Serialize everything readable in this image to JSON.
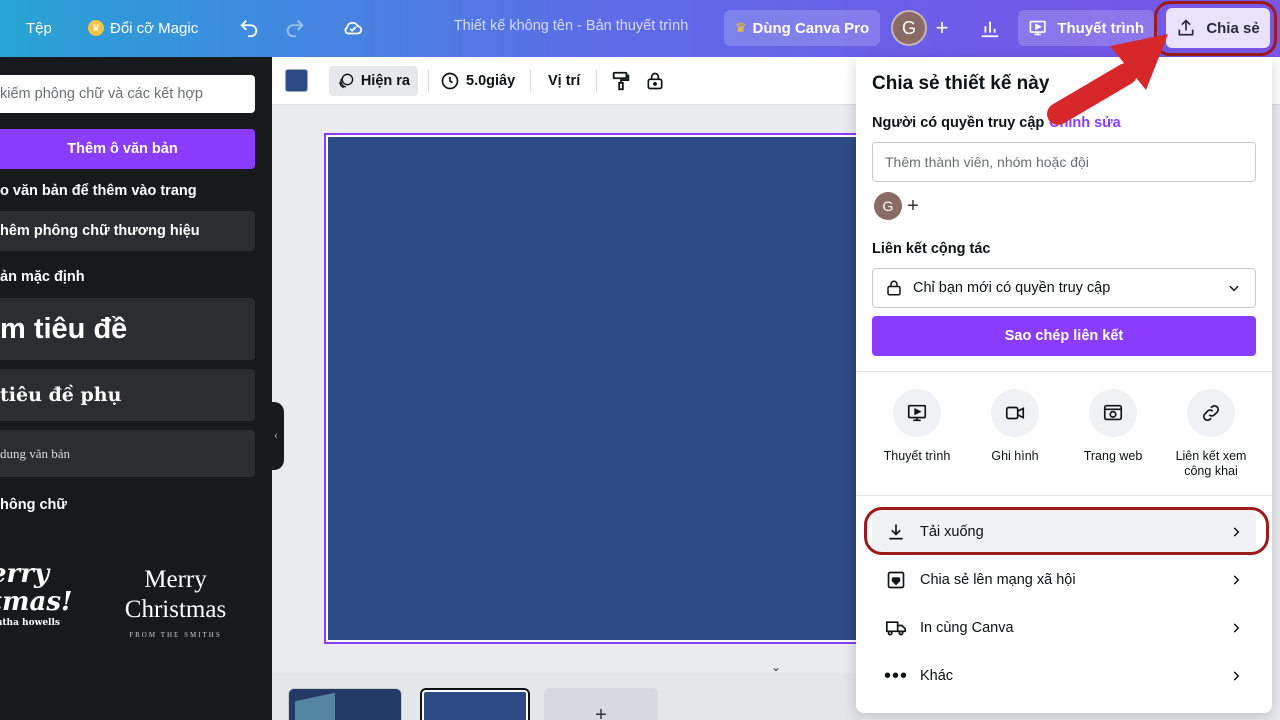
{
  "topbar": {
    "file_label": "Tệp",
    "magic_resize_label": "Đổi cỡ Magic",
    "doc_title": "Thiết kế không tên - Bản thuyết trình",
    "pro_label": "Dùng Canva Pro",
    "avatar_initial": "G",
    "present_label": "Thuyết trình",
    "share_label": "Chia sẻ"
  },
  "sidebar": {
    "search_placeholder": "kiếm phông chữ và các kết hợp",
    "add_textbox_label": "Thêm ô văn bản",
    "hint_text": "o văn bản để thêm vào trang",
    "brand_fonts_label": "hêm phông chữ thương hiệu",
    "default_styles_heading": "ản mặc định",
    "heading_sample": "m tiêu đề",
    "subheading_sample": "tiêu đề phụ",
    "body_sample": "dung văn bản",
    "font_combos_heading": "hông chữ",
    "combo_left": {
      "line1": "erry",
      "line2": "tmas!",
      "line3": "antha howells"
    },
    "combo_right": {
      "line1": "Merry",
      "line2": "Christmas",
      "line3": "FROM THE SMITHS"
    }
  },
  "toolbar": {
    "animate_label": "Hiện ra",
    "duration_label": "5.0giây",
    "position_label": "Vị trí"
  },
  "share_panel": {
    "title": "Chia sẻ thiết kế này",
    "access_label": "Người có quyền truy cập",
    "edit_link": "Chỉnh sửa",
    "invite_placeholder": "Thêm thành viên, nhóm hoặc đội",
    "avatar_initial": "G",
    "collab_link_label": "Liên kết cộng tác",
    "access_option": "Chỉ bạn mới có quyền truy cập",
    "copy_link_label": "Sao chép liên kết",
    "options": [
      {
        "label": "Thuyết trình",
        "icon": "present-icon"
      },
      {
        "label": "Ghi hình",
        "icon": "camera-icon"
      },
      {
        "label": "Trang web",
        "icon": "website-icon"
      },
      {
        "label": "Liên kết xem công khai",
        "icon": "link-icon"
      }
    ],
    "rows": [
      {
        "label": "Tải xuống",
        "icon": "download-icon"
      },
      {
        "label": "Chia sẻ lên mạng xã hội",
        "icon": "heart-icon"
      },
      {
        "label": "In cùng Canva",
        "icon": "truck-icon"
      },
      {
        "label": "Khác",
        "icon": "more-icon"
      }
    ]
  },
  "colors": {
    "accent": "#8b3dff",
    "slide_fill": "#2e4a84",
    "highlight_ring": "#9c1b1b",
    "arrow": "#d6282b"
  }
}
